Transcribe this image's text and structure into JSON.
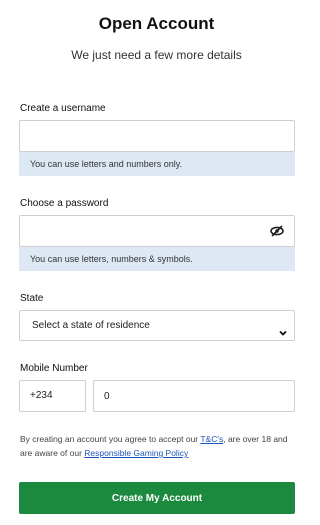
{
  "header": {
    "title": "Open Account",
    "subtitle": "We just need a few more details"
  },
  "username": {
    "label": "Create a username",
    "value": "",
    "hint": "You can use letters and numbers only."
  },
  "password": {
    "label": "Choose a password",
    "value": "",
    "hint": "You can use letters, numbers & symbols.",
    "toggle_icon": "eye-slash-icon"
  },
  "state": {
    "label": "State",
    "selected": "Select a state of residence",
    "icon": "chevron-down-icon"
  },
  "mobile": {
    "label": "Mobile Number",
    "country_code": "+234",
    "number_value": "0"
  },
  "terms": {
    "prefix": "By creating an account you agree to accept our ",
    "tcs_link": "T&C's",
    "middle": ", are over 18 and are aware of our ",
    "policy_link": "Responsible Gaming Policy"
  },
  "cta": {
    "label": "Create My Account"
  },
  "colors": {
    "cta": "#1c8a3e",
    "hint_bg": "#dde8f4",
    "link": "#1a55b8"
  }
}
